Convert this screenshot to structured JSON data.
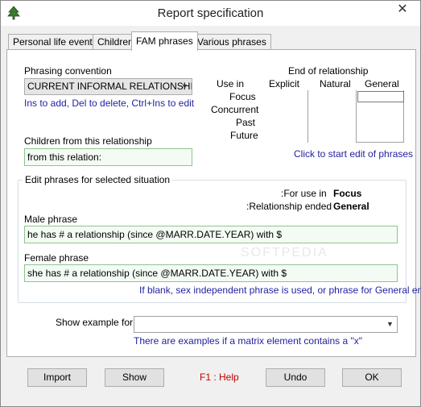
{
  "window": {
    "title": "Report specification",
    "close_glyph": "✕",
    "icon": "tree-icon",
    "accent": "#3c7a2e"
  },
  "tabs": [
    {
      "label": "Personal life events",
      "active": false
    },
    {
      "label": "Children",
      "active": false
    },
    {
      "label": "FAM phrases",
      "active": true
    },
    {
      "label": "Various phrases",
      "active": false
    }
  ],
  "phrasing": {
    "label": "Phrasing convention",
    "selected": "CURRENT INFORMAL RELATIONSHI",
    "hint": "Ins to add, Del to delete, Ctrl+Ins to edit"
  },
  "matrix": {
    "title": "End of relationship",
    "use_in_label": "Use in",
    "columns": [
      "Explicit",
      "Natural",
      "General"
    ],
    "rows": [
      "Focus",
      "Concurrent",
      "Past",
      "Future"
    ],
    "click_hint": "Click to start edit of phrases"
  },
  "children": {
    "label": "Children from this relationship",
    "value": "from this relation:"
  },
  "edit_group": {
    "title": "Edit phrases for selected situation",
    "for_use_in_label": ":For use in",
    "for_use_in_value": "Focus",
    "ended_label": ":Relationship ended",
    "ended_value": "General",
    "male_label": "Male phrase",
    "male_value": "he has # a relationship (since @MARR.DATE.YEAR) with $",
    "female_label": "Female phrase",
    "female_value": "she has # a relationship (since @MARR.DATE.YEAR) with $",
    "blank_hint": "If blank, sex independent phrase is used, or phrase for General end"
  },
  "example": {
    "label": "Show example for",
    "selected": "",
    "hint": "There are examples if a matrix element contains a \"x\""
  },
  "buttons": {
    "import": "Import",
    "show": "Show",
    "help": "F1 : Help",
    "undo": "Undo",
    "ok": "OK"
  },
  "colors": {
    "hint_blue": "#1f1fa0",
    "help_red": "#c00000",
    "field_green_border": "#8fc48f"
  }
}
